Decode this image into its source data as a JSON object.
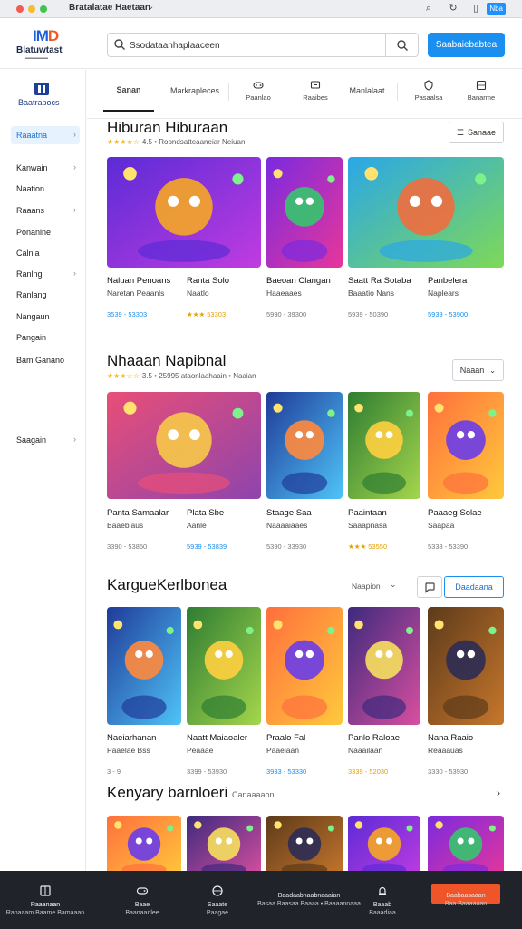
{
  "window": {
    "title": "Bratalatae Haetaan",
    "badge": "Nba"
  },
  "header": {
    "logo_text": "Blatuwtast",
    "search_value": "Ssodataanhaplaaceen",
    "primary_button": "Saabaiebabtea"
  },
  "sidebar": {
    "title": "Baatrapocs",
    "items": [
      {
        "label": "Raaatna",
        "active": true,
        "chevron": true
      },
      {
        "label": "Kanwain",
        "active": false,
        "chevron": true
      },
      {
        "label": "Naation",
        "active": false,
        "chevron": false
      },
      {
        "label": "Raaans",
        "active": false,
        "chevron": true
      },
      {
        "label": "Ponanine",
        "active": false,
        "chevron": false
      },
      {
        "label": "Calnia",
        "active": false,
        "chevron": false
      },
      {
        "label": "Ranlng",
        "active": false,
        "chevron": true
      },
      {
        "label": "Ranlang",
        "active": false,
        "chevron": false
      },
      {
        "label": "Nangaun",
        "active": false,
        "chevron": false
      },
      {
        "label": "Pangain",
        "active": false,
        "chevron": false
      },
      {
        "label": "Bam Ganano",
        "active": false,
        "chevron": false
      },
      {
        "label": "Saagain",
        "active": false,
        "chevron": true
      }
    ]
  },
  "tabs": [
    {
      "label": "Sanan",
      "icon": "",
      "active": true
    },
    {
      "label": "Markrapleces",
      "icon": "",
      "active": false
    },
    {
      "label": "Paanlao",
      "icon": "gamepad-icon",
      "active": false
    },
    {
      "label": "Raaibes",
      "icon": "tv-icon",
      "active": false
    },
    {
      "label": "Manlalaat",
      "icon": "",
      "active": false
    },
    {
      "label": "Pasaalsa",
      "icon": "shield-icon",
      "active": false
    },
    {
      "label": "Banarme",
      "icon": "grid-icon",
      "active": false
    }
  ],
  "sections": [
    {
      "title": "Hiburan Hiburaan",
      "subtitle": "4.5 • Roondsatteaaneiar Neiuan",
      "button": "Sanaae",
      "cards": [
        {
          "title": "Naluan Penoans",
          "sub": "Naretan Peaanls",
          "meta": "3539 - 53303",
          "meta_style": "blue"
        },
        {
          "title": "Ranta Solo",
          "sub": "Naatlo",
          "meta": "★★★ 53303",
          "meta_style": "gold"
        },
        {
          "title": "Baeoan Clangan",
          "sub": "Haaeaaes",
          "meta": "5990 - 39300",
          "meta_style": "plain"
        },
        {
          "title": "Saatt Ra Sotaba",
          "sub": "Baaatio Nans",
          "meta": "5939 - 50390",
          "meta_style": "plain"
        },
        {
          "title": "Panbelera",
          "sub": "Naplears",
          "meta": "5939 - 53900",
          "meta_style": "blue"
        }
      ]
    },
    {
      "title": "Nhaaan Napibnal",
      "subtitle": "3.5 • 25995 ataonlaahaain • Naaian",
      "button": "Naaan",
      "cards": [
        {
          "title": "Panta Samaalar",
          "sub": "Baaebiaus",
          "meta": "3390 - 53850",
          "meta_style": "plain"
        },
        {
          "title": "Plata Sbe",
          "sub": "Aanle",
          "meta": "5939 - 53839",
          "meta_style": "blue"
        },
        {
          "title": "Staage Saa",
          "sub": "Naaaaiaaes",
          "meta": "5390 - 33930",
          "meta_style": "plain"
        },
        {
          "title": "Paaintaan",
          "sub": "Saaapnasa",
          "meta": "★★★ 53550",
          "meta_style": "gold"
        },
        {
          "title": "Paaaeg Solae",
          "sub": "Saapaa",
          "meta": "5338 - 53390",
          "meta_style": "plain"
        }
      ]
    },
    {
      "title": "KargueKerlbonea",
      "sort": "Naapion",
      "button": "Daadaana",
      "cards": [
        {
          "title": "Naeiarhanan",
          "sub": "Paaelae Bss",
          "meta": "3 - 9",
          "meta_style": "plain"
        },
        {
          "title": "Naatt Maiaoaler",
          "sub": "Peaaae",
          "meta": "3399 - 53930",
          "meta_style": "plain"
        },
        {
          "title": "Praalo Fal",
          "sub": "Paaelaan",
          "meta": "3933 - 53330",
          "meta_style": "blue"
        },
        {
          "title": "Panlo Raloae",
          "sub": "Naaailaan",
          "meta": "3339 - 52030",
          "meta_style": "gold"
        },
        {
          "title": "Nana Raaio",
          "sub": "Reaaauas",
          "meta": "3330 - 53930",
          "meta_style": "plain"
        }
      ]
    },
    {
      "title": "Kenyary barnloeri",
      "subtitle": "Canaaaaon"
    }
  ],
  "bottom_bar": [
    {
      "line1": "Raaanaan",
      "line2": "Ranaaam Baame Bamaaan",
      "icon": "book-icon",
      "active": true
    },
    {
      "line1": "Baae",
      "line2": "Baanaanlee",
      "icon": "gamepad-icon",
      "active": false
    },
    {
      "line1": "Saaate",
      "line2": "Paagae",
      "icon": "globe-icon",
      "active": false
    },
    {
      "line1": "Baadaabnaabnaaaian",
      "line2": "Basaa Baasaa Baaaa • Baaaannaaa",
      "icon": "",
      "active": false
    },
    {
      "line1": "Baaab",
      "line2": "Baaadiaa",
      "icon": "bell-icon",
      "active": false
    },
    {
      "line1": "Baabaasaaan",
      "line2": "Baa Baaaaaan",
      "icon": "",
      "active": false,
      "promo": true
    }
  ]
}
